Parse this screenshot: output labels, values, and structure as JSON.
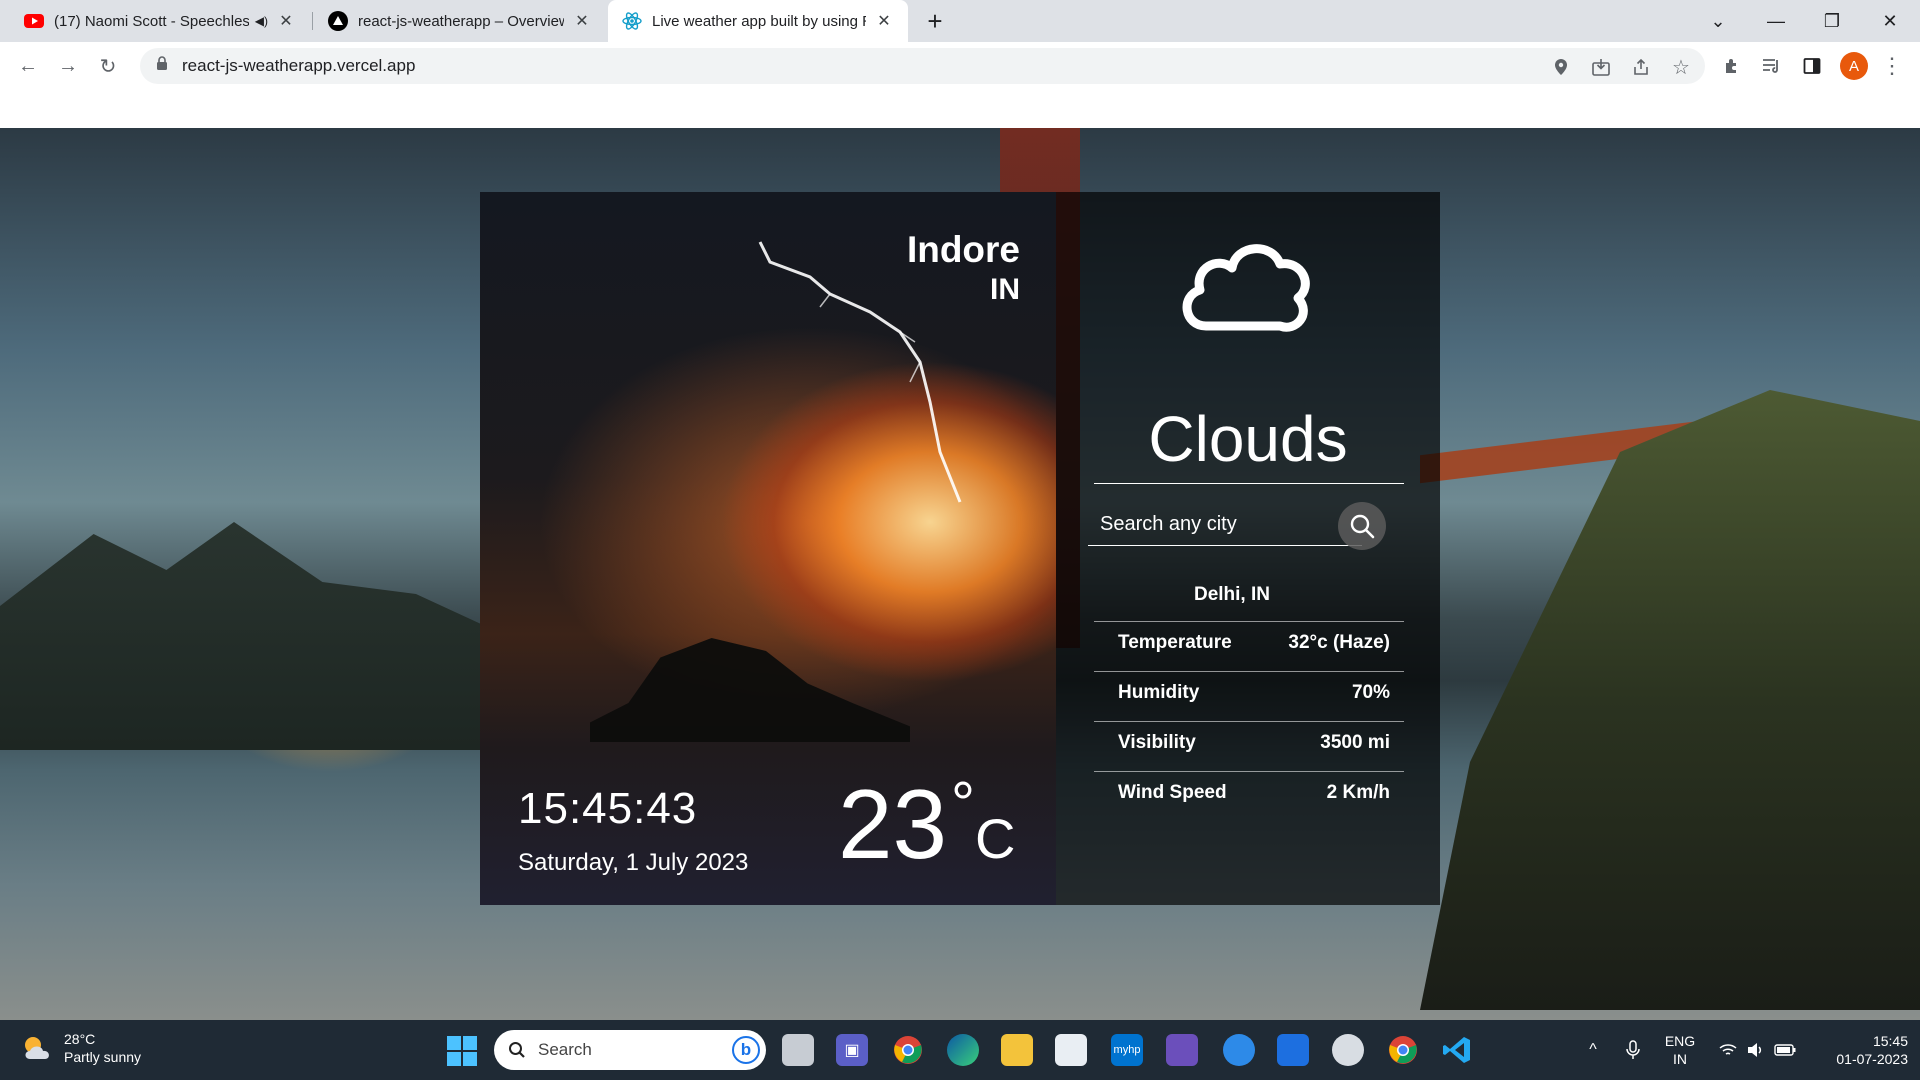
{
  "browser": {
    "tabs": [
      {
        "title": "(17) Naomi Scott - Speechles",
        "favicon": "youtube-icon",
        "audio": true
      },
      {
        "title": "react-js-weatherapp – Overview",
        "favicon": "vercel-icon"
      },
      {
        "title": "Live weather app built by using R",
        "favicon": "react-icon",
        "active": true
      }
    ],
    "new_tab": "+",
    "url": "react-js-weatherapp.vercel.app",
    "profile_initial": "A"
  },
  "app": {
    "city": "Indore",
    "country": "IN",
    "time": "15:45:43",
    "date": "Saturday, 1 July 2023",
    "temperature": "23",
    "degree": "°",
    "unit": "C",
    "condition": "Clouds",
    "search_placeholder": "Search any city",
    "result": {
      "location": "Delhi, IN",
      "stats": [
        {
          "label": "Temperature",
          "value": "32°c (Haze)"
        },
        {
          "label": "Humidity",
          "value": "70%"
        },
        {
          "label": "Visibility",
          "value": "3500 mi"
        },
        {
          "label": "Wind Speed",
          "value": "2 Km/h"
        }
      ]
    }
  },
  "taskbar": {
    "weather_temp": "28°C",
    "weather_desc": "Partly sunny",
    "search_label": "Search",
    "language_1": "ENG",
    "language_2": "IN",
    "time": "15:45",
    "date": "01-07-2023"
  }
}
